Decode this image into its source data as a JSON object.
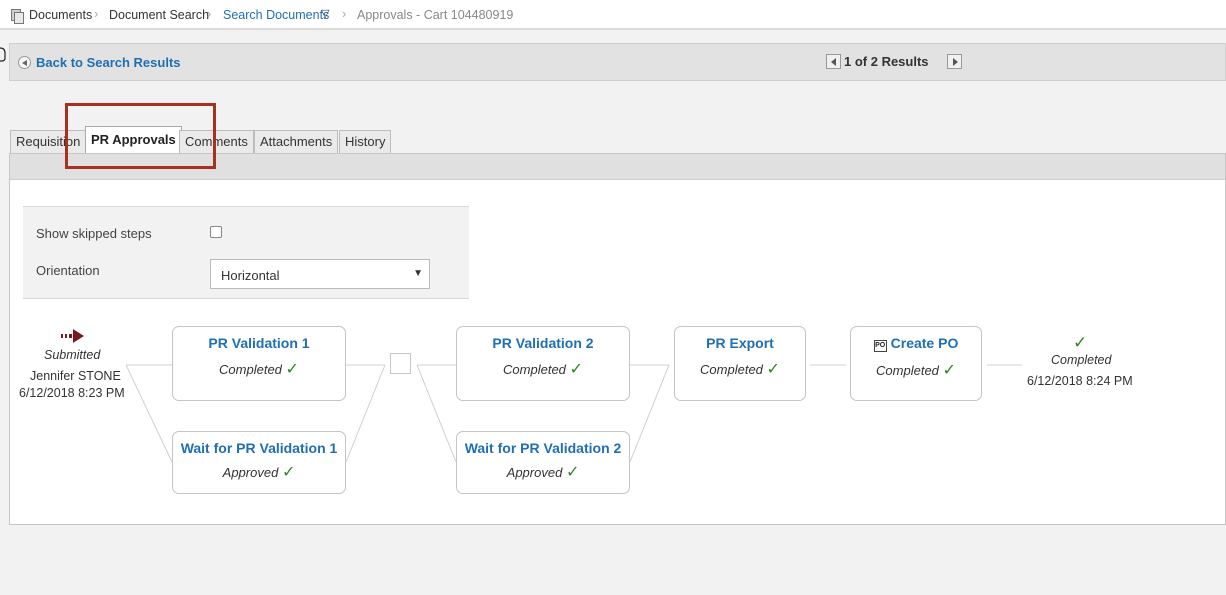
{
  "breadcrumb": {
    "items": [
      "Documents",
      "Document Search",
      "Search Documents",
      "Approvals - Cart 104480919"
    ]
  },
  "result_bar": {
    "back_label": "Back to Search Results",
    "pager_text": "1 of 2 Results"
  },
  "tabs": [
    {
      "label": "Requisition"
    },
    {
      "label": "PR Approvals",
      "active": true
    },
    {
      "label": "Comments"
    },
    {
      "label": "Attachments"
    },
    {
      "label": "History"
    }
  ],
  "options": {
    "skipped_label": "Show skipped steps",
    "skipped_checked": false,
    "orientation_label": "Orientation",
    "orientation_value": "Horizontal"
  },
  "flow": {
    "start": {
      "status": "Submitted",
      "user": "Jennifer STONE",
      "date": "6/12/2018 8:23 PM"
    },
    "nodes": [
      {
        "title": "PR Validation 1",
        "status": "Completed"
      },
      {
        "title": "Wait for PR Validation 1",
        "status": "Approved"
      },
      {
        "title": "PR Validation 2",
        "status": "Completed"
      },
      {
        "title": "Wait for PR Validation 2",
        "status": "Approved"
      },
      {
        "title": "PR Export",
        "status": "Completed"
      },
      {
        "title": "Create PO",
        "status": "Completed"
      }
    ],
    "end": {
      "status": "Completed",
      "date": "6/12/2018 8:24 PM"
    }
  },
  "colors": {
    "link": "#1f6fb2",
    "check": "#2a8a1f",
    "highlight": "#a5321e",
    "start_arrow": "#7a1a1a"
  }
}
